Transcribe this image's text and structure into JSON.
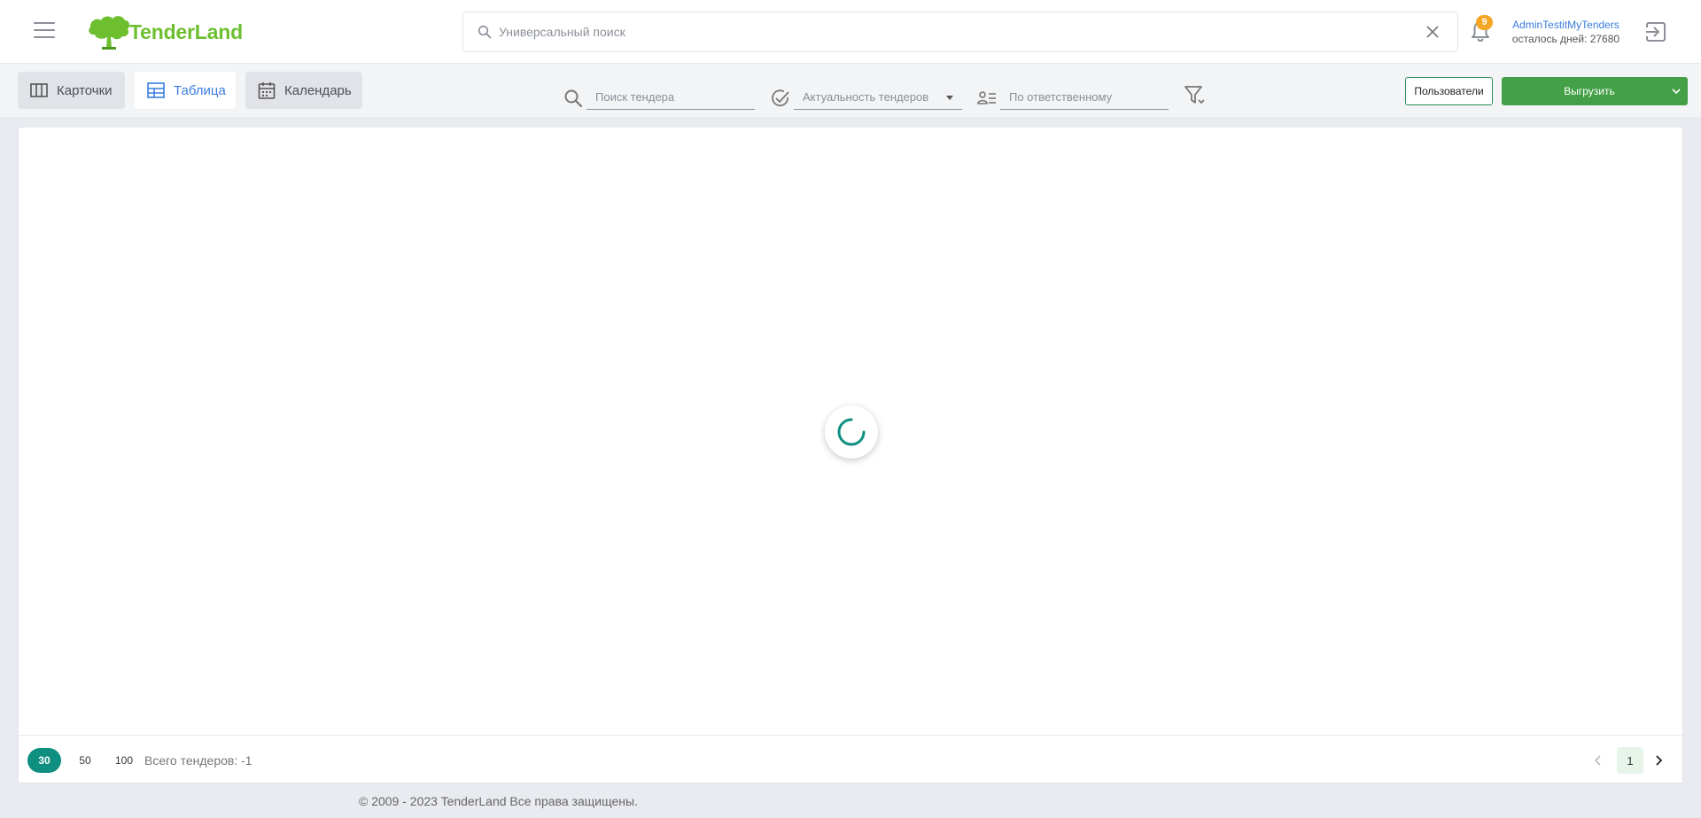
{
  "header": {
    "logo_text": "TenderLand",
    "search_placeholder": "Универсальный поиск",
    "notifications_count": "9",
    "user_name": "AdminTestitMyTenders",
    "days_left": "осталось дней: 27680"
  },
  "toolbar": {
    "views": {
      "cards": "Карточки",
      "table": "Таблица",
      "calendar": "Календарь"
    },
    "active_view": "table",
    "filters": {
      "search_placeholder": "Поиск тендера",
      "actuality_placeholder": "Актуальность тендеров",
      "responsible_placeholder": "По ответственному"
    },
    "users_button": "Пользователи",
    "export_button": "Выгрузить"
  },
  "pager": {
    "page_sizes": [
      "30",
      "50",
      "100"
    ],
    "selected_size": "30",
    "total_label": "Всего тендеров: -1",
    "current_page": "1"
  },
  "footer": {
    "copyright": "© 2009 - 2023 TenderLand Все права защищены."
  },
  "colors": {
    "brand_green": "#6dbf2f",
    "accent_teal": "#0f8f80",
    "export_green": "#43a047",
    "link_blue": "#3b7ddd",
    "badge_orange": "#f5a623"
  }
}
